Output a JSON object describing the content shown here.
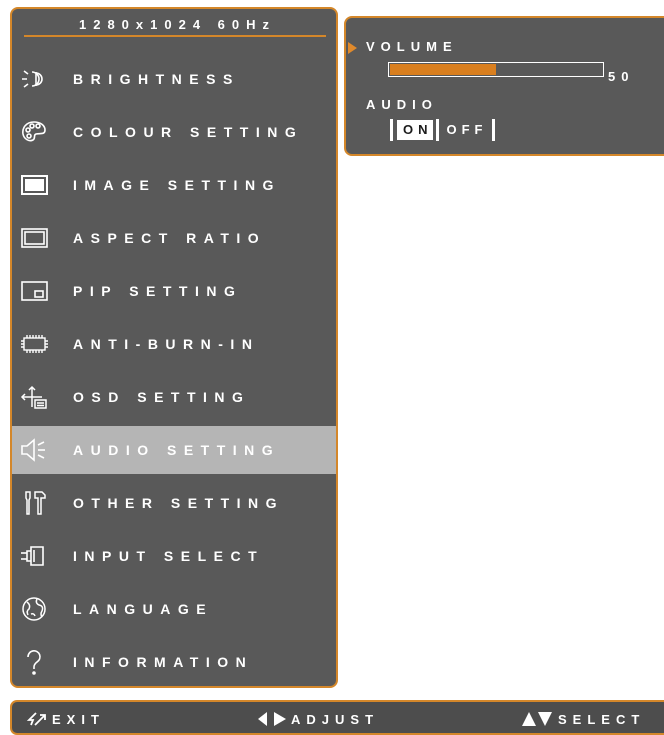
{
  "resolution": "1280x1024 60Hz",
  "menu": [
    {
      "label": "BRIGHTNESS",
      "icon": "brightness-icon"
    },
    {
      "label": "COLOUR SETTING",
      "icon": "palette-icon"
    },
    {
      "label": "IMAGE SETTING",
      "icon": "image-screen-icon"
    },
    {
      "label": "ASPECT RATIO",
      "icon": "aspect-ratio-icon"
    },
    {
      "label": "PIP SETTING",
      "icon": "pip-icon"
    },
    {
      "label": "ANTI-BURN-IN",
      "icon": "chip-icon"
    },
    {
      "label": "OSD SETTING",
      "icon": "osd-move-icon"
    },
    {
      "label": "AUDIO SETTING",
      "icon": "speaker-icon"
    },
    {
      "label": "OTHER SETTING",
      "icon": "tools-icon"
    },
    {
      "label": "INPUT SELECT",
      "icon": "input-plug-icon"
    },
    {
      "label": "LANGUAGE",
      "icon": "globe-icon"
    },
    {
      "label": "INFORMATION",
      "icon": "question-icon"
    }
  ],
  "selected_menu": "AUDIO SETTING",
  "submenu": {
    "volume_label": "VOLUME",
    "volume_value": "50",
    "volume_level": 0.5,
    "audio_label": "AUDIO",
    "audio_on": "ON",
    "audio_off": "OFF",
    "audio_selected": "ON"
  },
  "footer": {
    "exit": "EXIT",
    "adjust": "ADJUST",
    "select": "SELECT"
  },
  "colors": {
    "panel": "#595959",
    "border": "#d4872a",
    "highlight": "#b5b5b5",
    "slider_fill": "#d97f1f"
  }
}
